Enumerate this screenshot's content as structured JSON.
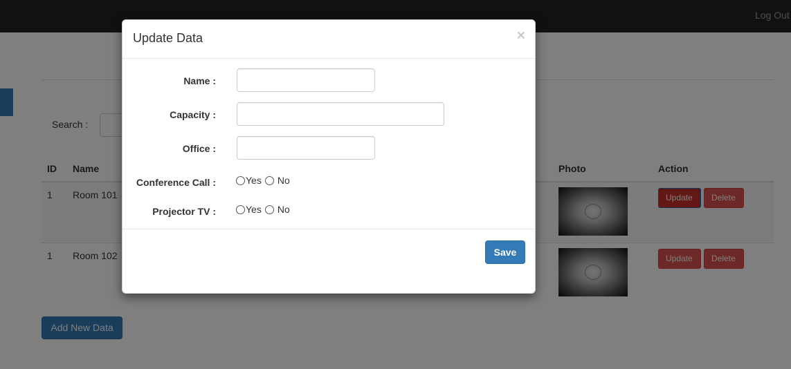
{
  "navbar": {
    "logout_label": "Log Out"
  },
  "search": {
    "label": "Search :",
    "value": ""
  },
  "table": {
    "headers": {
      "id": "ID",
      "name": "Name",
      "photo": "Photo",
      "action": "Action"
    },
    "rows": [
      {
        "id": "1",
        "name": "Room 101",
        "update_label": "Update",
        "delete_label": "Delete"
      },
      {
        "id": "1",
        "name": "Room 102",
        "update_label": "Update",
        "delete_label": "Delete"
      }
    ]
  },
  "add_button_label": "Add New Data",
  "modal": {
    "title": "Update Data",
    "close_glyph": "×",
    "fields": {
      "name": {
        "label": "Name :",
        "value": ""
      },
      "capacity": {
        "label": "Capacity :",
        "value": ""
      },
      "office": {
        "label": "Office :",
        "value": ""
      }
    },
    "conference_call": {
      "label": "Conference Call :",
      "yes": "Yes",
      "no": "No"
    },
    "projector_tv": {
      "label": "Projector TV :",
      "yes": "Yes",
      "no": "No"
    },
    "save_label": "Save"
  },
  "colors": {
    "primary": "#337ab7",
    "danger": "#d9534f",
    "navbar": "#222222"
  },
  "icons": {
    "close": "close-icon",
    "radio": "radio-circle-icon"
  }
}
